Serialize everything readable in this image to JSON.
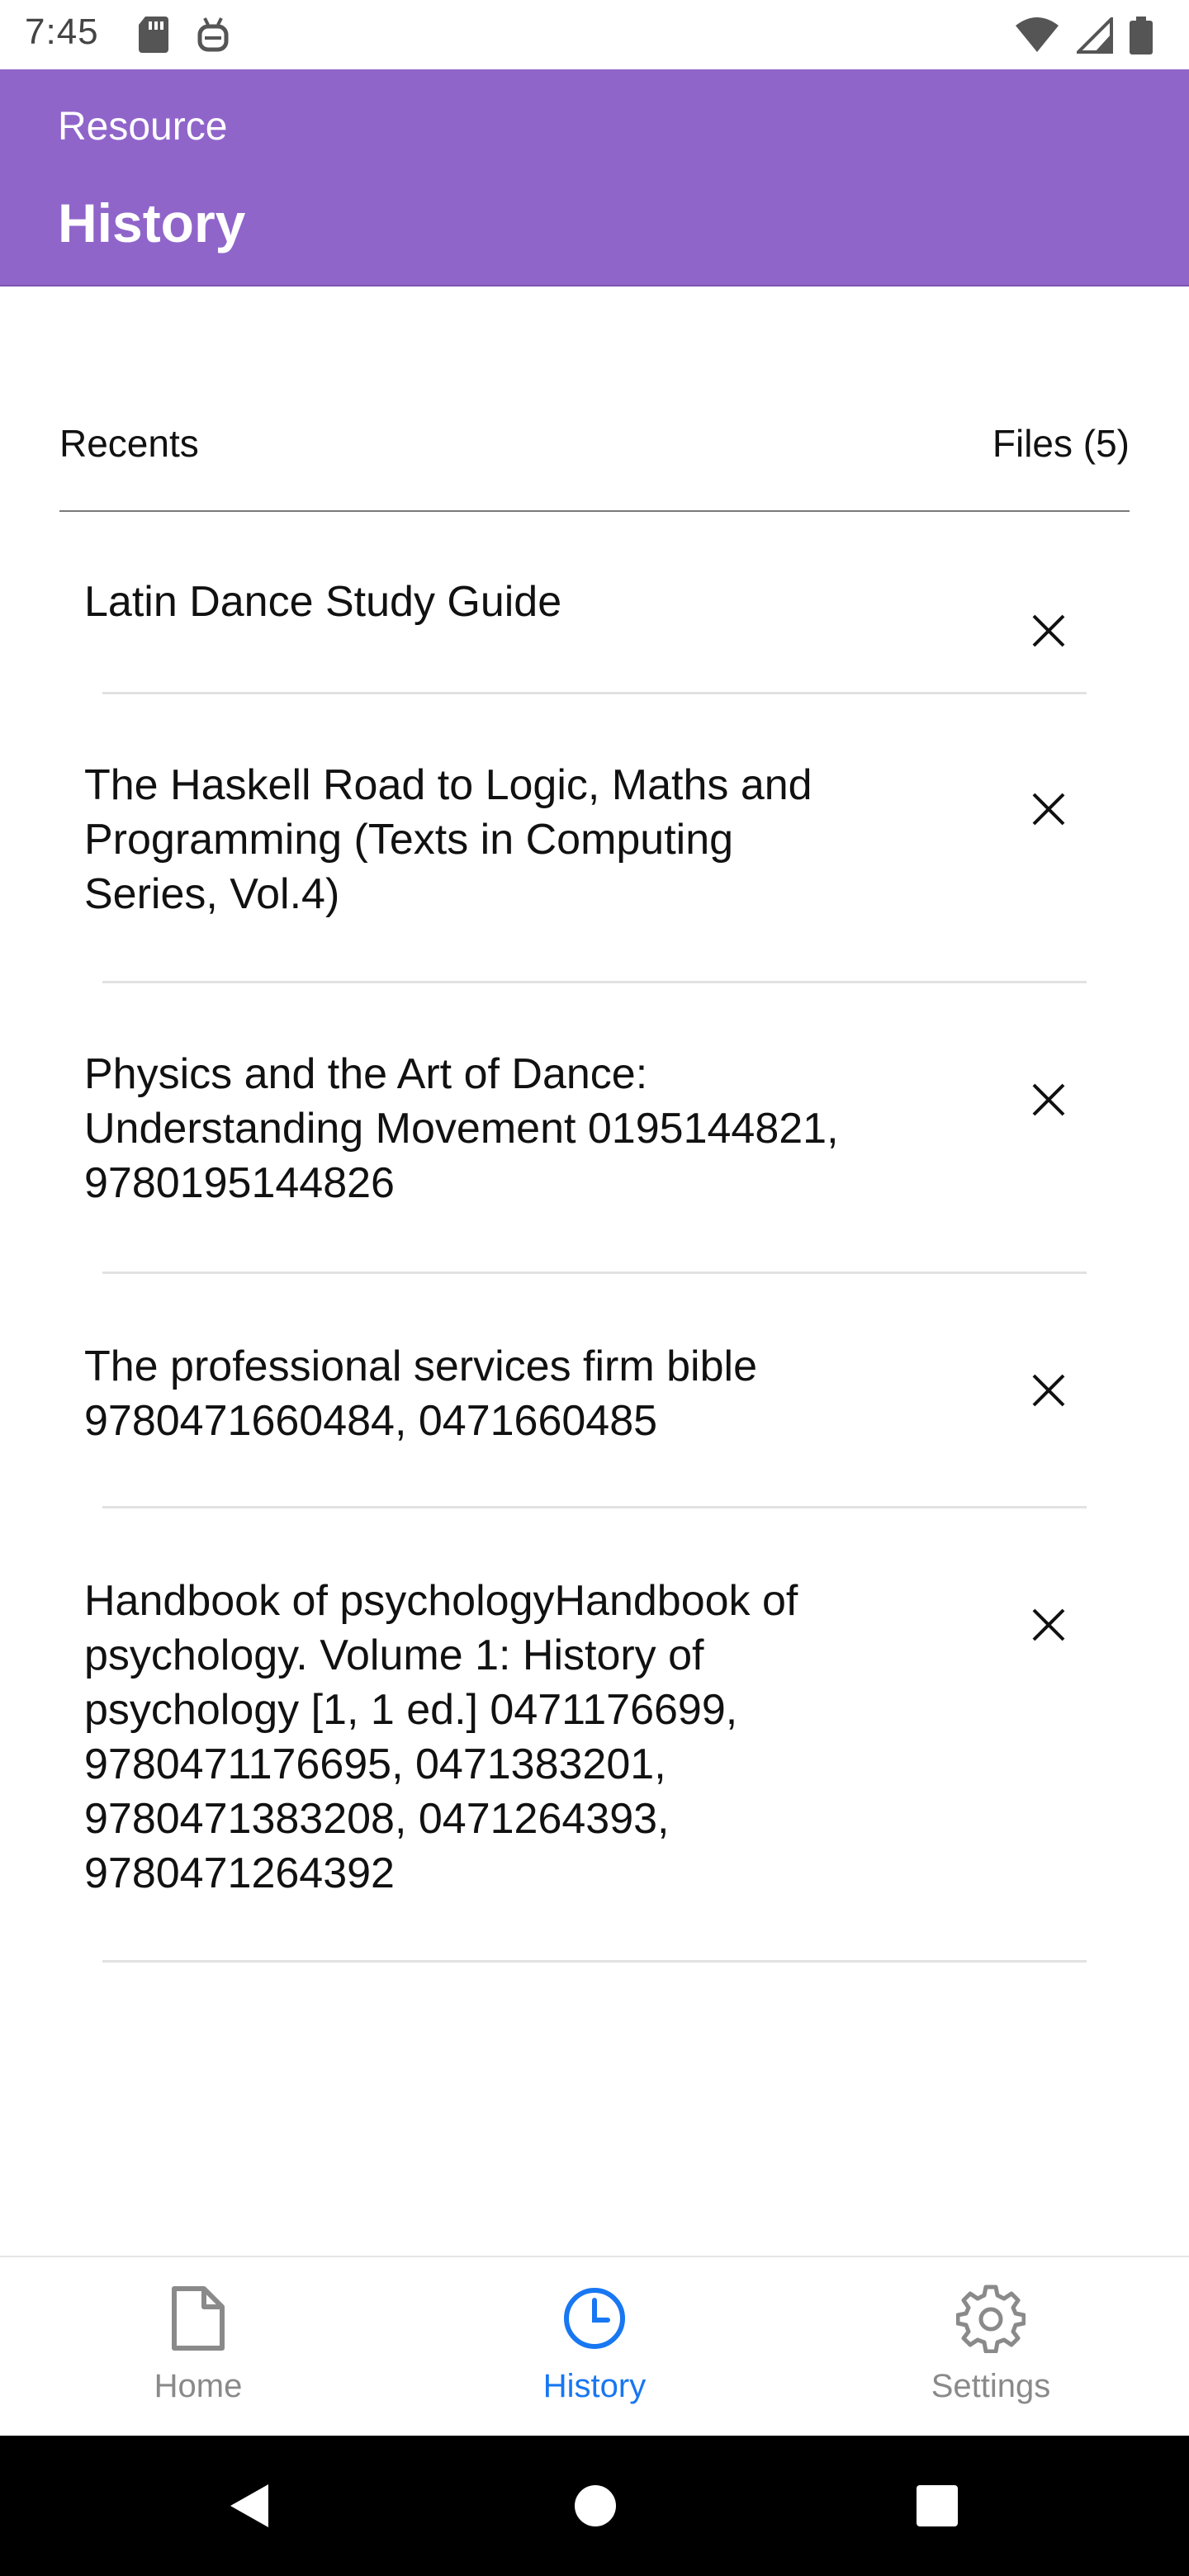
{
  "status_bar": {
    "time": "7:45"
  },
  "app_bar": {
    "subtitle": "Resource",
    "title": "History",
    "color": "#9065CA"
  },
  "list": {
    "recents_label": "Recents",
    "files_count": "Files (5)",
    "items": [
      {
        "title": "Latin Dance Study Guide"
      },
      {
        "title": "The Haskell Road to Logic, Maths and Programming (Texts in Computing Series, Vol.4)"
      },
      {
        "title": "Physics and the Art of Dance: Understanding Movement 0195144821, 9780195144826"
      },
      {
        "title": "The professional services firm bible 9780471660484, 0471660485"
      },
      {
        "title": "Handbook of psychologyHandbook of psychology. Volume 1: History of psychology [1, 1 ed.] 0471176699, 9780471176695,  0471383201, 9780471383208,  0471264393, 9780471264392"
      }
    ]
  },
  "bottom_nav": {
    "items": [
      {
        "label": "Home",
        "icon": "document-icon",
        "active": false
      },
      {
        "label": "History",
        "icon": "clock-icon",
        "active": true
      },
      {
        "label": "Settings",
        "icon": "gear-icon",
        "active": false
      }
    ],
    "active_color": "#1877f2",
    "inactive_color": "#8a8a8a"
  }
}
